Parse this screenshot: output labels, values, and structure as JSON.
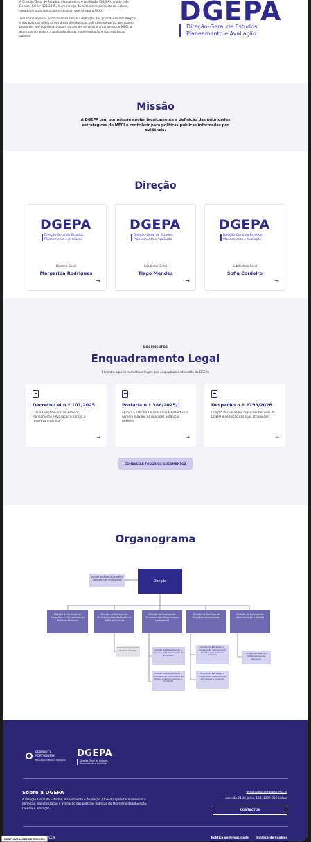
{
  "header": {
    "intro_p1": "A Direção-Geral de Estudos, Planeamento e Avaliação (DGEPA), criada pelo Decreto-Lei n.º 125/2025, é um serviço da administração direta do Estado, dotado de autonomia administrativa, que integra o MECI.",
    "intro_p2": "Tem como objetivo apoiar tecnicamente a definição das prioridades estratégicas e das políticas públicas nas áreas da educação, ciência e inovação, bem como promover, em coordenação com os demais serviços e organismos do MECI, o acompanhamento e a avaliação da sua implementação e dos resultados obtidos.",
    "logo_mark": "DGEPA",
    "logo_line1": "Direção-Geral de Estudos,",
    "logo_line2": "Planeamento e Avaliação"
  },
  "mission": {
    "title": "Missão",
    "text": "A DGEPA tem por missão apoiar tecnicamente a definição das prioridades estratégicas do MECI e contribuir para políticas públicas informadas por evidência."
  },
  "direcao": {
    "title": "Direção",
    "cards": [
      {
        "logo": "DGEPA",
        "logo_line1": "Direção-Geral de Estudos,",
        "logo_line2": "Planeamento e Avaliação",
        "role": "Diretora-Geral",
        "name": "Margarida Rodrigues",
        "arrow": "→"
      },
      {
        "logo": "DGEPA",
        "logo_line1": "Direção-Geral de Estudos,",
        "logo_line2": "Planeamento e Avaliação",
        "role": "Subdiretor-Geral",
        "name": "Tiago Mendes",
        "arrow": "→"
      },
      {
        "logo": "DGEPA",
        "logo_line1": "Direção-Geral de Estudos,",
        "logo_line2": "Planeamento e Avaliação",
        "role": "Subdiretora-Geral",
        "name": "Sofia Cordeiro",
        "arrow": "→"
      }
    ]
  },
  "legal": {
    "kicker": "DOCUMENTOS",
    "title": "Enquadramento Legal",
    "lead": "Encontre aqui os normativos legais que enquadram a atividade da DGEPA",
    "docs": [
      {
        "title": "Decreto-Lei n.º 101/2025",
        "desc": "Cria a Direção-Geral de Estudos, Planeamento e Avaliação e aprova a respetiva orgânica.",
        "arrow": "→"
      },
      {
        "title": "Portaria n.º 386/2025/1",
        "desc": "Aprova a estrutura nuclear da DGEPA e fixa o número máximo de unidades orgânicas flexíveis.",
        "arrow": "→"
      },
      {
        "title": "Despacho n.º 2793/2026",
        "desc": "Criação das unidades orgânicas flexíveis da DGEPA e definição das suas atribuições.",
        "arrow": "→"
      }
    ],
    "button": "CONSULTAR TODOS OS DOCUMENTOS"
  },
  "organo": {
    "title": "Organograma",
    "root": "Direção",
    "support": "Divisão de Apoio à Direção e Comunicação Institucional",
    "services": [
      "Direção de Serviços de Prospetiva e Planeamento de Políticas Públicas",
      "Direção de Serviços de Monitorização e Avaliação de Políticas Públicas",
      "Direção de Serviços de Planeamento e Coordenação Orçamental",
      "Direção de Serviços de Relações Internacionais",
      "Direção de Serviços de Administração e Gestão"
    ],
    "sub_monit": "Unidade Orçamental de Monitorização",
    "sub_plan1": "Divisão de Planeamento e Coordenação Orçamental da Educação",
    "sub_plan2": "Divisão de Planeamento e Coordenação Orçamental do Ensino Superior, Ciência e Inovação",
    "sub_rel1": "Divisão de Estratégia e Cooperação Internacional em Educação e Ensino Superior",
    "sub_rel2": "Divisão de Estratégia e Cooperação Internacional em Ciência e Inovação",
    "sub_adm": "Divisão de Gestão e Administração de Recursos"
  },
  "footer": {
    "rp_line1": "REPÚBLICA",
    "rp_line2": "PORTUGUESA",
    "rp_line3": "EDUCAÇÃO, CIÊNCIA E INOVAÇÃO",
    "logo": "DGEPA",
    "logo_line1": "Direção-Geral de Estudos,",
    "logo_line2": "Planeamento e Avaliação",
    "about_title": "Sobre a DGEPA",
    "about_text": "A Direção-Geral de Estudos, Planeamento e Avaliação (DGEPA) apoia tecnicamente a definição, monitorização e avaliação das políticas públicas do Ministério da Educação, Ciência e Inovação.",
    "email": "geral.dgepa@dgepa.meci.pt",
    "address": "Avenida 24 de Julho, 134, 1399-054 Lisboa",
    "contacts_button": "CONTACTOS",
    "copyright": "© 2026 DGEPA - PCCN",
    "link_privacy": "Política de Privacidade",
    "link_cookies": "Política de Cookies"
  },
  "cookie_button": "CONFIGURAÇÕES DE COOKIES",
  "colors": {
    "brand": "#2c2676",
    "accent": "#3a33c9",
    "box": "#6f6bb3",
    "box_light": "#d6d3f0"
  }
}
